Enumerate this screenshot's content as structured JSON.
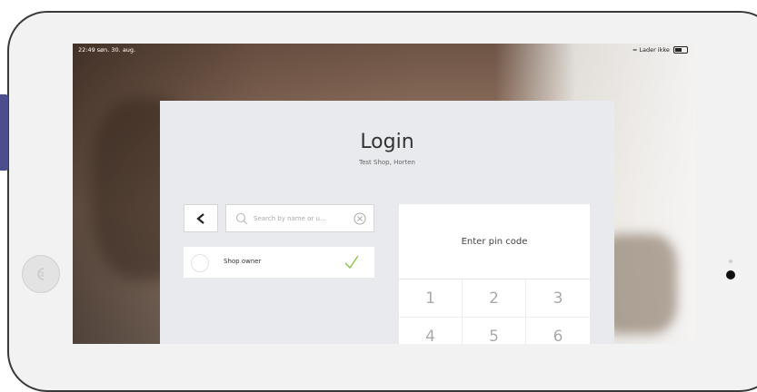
{
  "statusbar": {
    "time": "22:49  søn. 30. aug.",
    "charging": "Lader ikke"
  },
  "login": {
    "title": "Login",
    "subtitle": "Test Shop, Horten",
    "search_placeholder": "Search by name or u...",
    "users": [
      {
        "name": "Shop owner",
        "selected": true
      }
    ],
    "pin_label": "Enter pin code",
    "keys": [
      "1",
      "2",
      "3",
      "4",
      "5",
      "6"
    ]
  },
  "icons": [
    "back-chevron-icon",
    "search-icon",
    "clear-icon",
    "avatar-icon",
    "check-icon",
    "wifi-icon",
    "battery-icon",
    "home-button-icon"
  ],
  "colors": {
    "accent_check": "#8bc34a",
    "modal_bg": "#e8eaed"
  }
}
